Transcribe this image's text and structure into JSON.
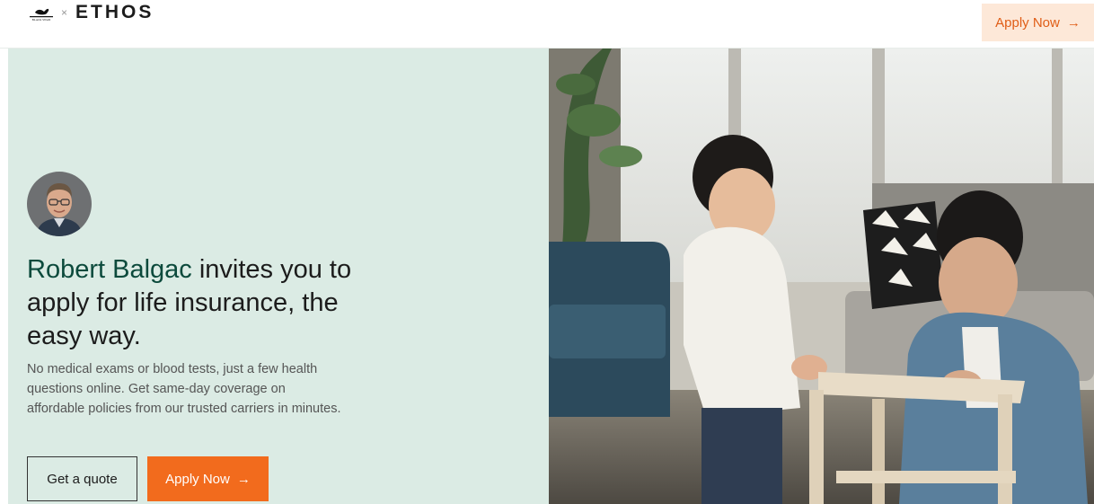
{
  "header": {
    "partner_logo_text": "BLACK SWAN",
    "separator": "×",
    "brand": "ETHOS",
    "apply_label": "Apply Now",
    "apply_arrow": "→"
  },
  "hero": {
    "inviter_name": "Robert Balgac",
    "headline_rest": " invites you to apply for life insurance, the easy way.",
    "description": "No medical exams or blood tests, just a few health questions online. Get same-day coverage on affordable policies from our trusted carriers in minutes.",
    "quote_label": "Get a quote",
    "apply_label": "Apply Now",
    "apply_arrow": "→"
  },
  "colors": {
    "panel_bg": "#dbebe4",
    "accent_orange": "#f26b1d",
    "name_green": "#0c4a3c"
  }
}
